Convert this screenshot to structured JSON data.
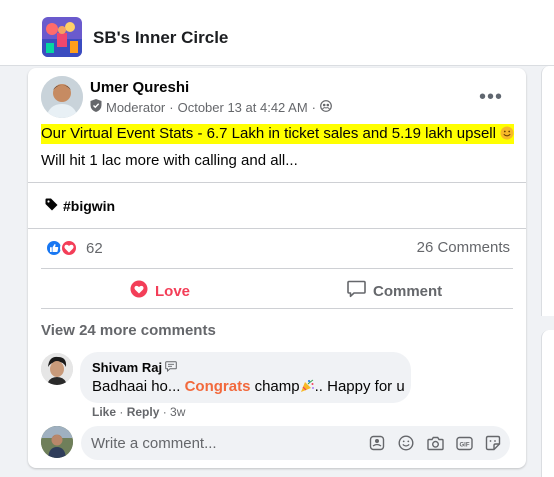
{
  "group": {
    "name": "SB's Inner Circle",
    "thumbnail_icon": "group-thumbnail"
  },
  "post": {
    "author": "Umer Qureshi",
    "role": "Moderator",
    "timestamp": "October 13 at 4:42 AM",
    "audience_icon": "members-icon",
    "more_icon": "more-options-icon",
    "text_line1": "Our Virtual Event Stats - 6.7 Lakh in ticket sales and 5.19 lakh upsell",
    "text_line1_emoji": "smile-emoji",
    "text_line2": "Will hit 1 lac more with calling and all...",
    "hashtag": "#bigwin",
    "reaction_count": "62",
    "comments_count": "26 Comments",
    "highlight_color": "#ffff00"
  },
  "actions": {
    "love": "Love",
    "comment": "Comment",
    "love_color": "#f33e58"
  },
  "comments": {
    "view_more": "View 24 more comments",
    "items": [
      {
        "author": "Shivam Raj",
        "text_before": "Badhaai ho...",
        "congrats": "Congrats",
        "text_after": "champ",
        "text_end": ".. Happy for u",
        "like": "Like",
        "reply": "Reply",
        "time": "3w"
      }
    ]
  },
  "composer": {
    "placeholder": "Write a comment...",
    "icons": [
      "avatar-sticker-icon",
      "emoji-icon",
      "camera-icon",
      "gif-icon",
      "sticker-icon"
    ]
  }
}
